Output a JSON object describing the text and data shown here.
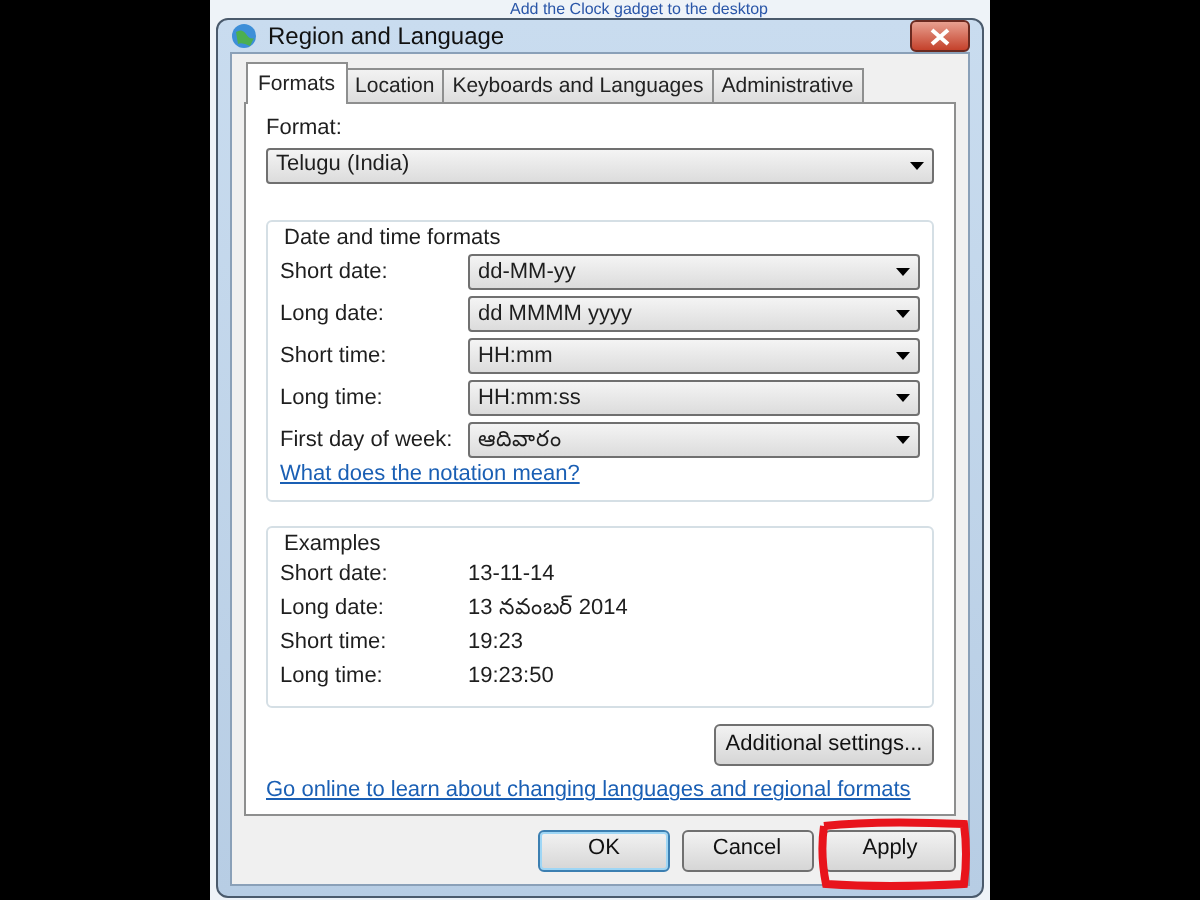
{
  "background_text": "Add the Clock gadget to the desktop",
  "window": {
    "title": "Region and Language"
  },
  "tabs": [
    {
      "label": "Formats",
      "selected": true
    },
    {
      "label": "Location",
      "selected": false
    },
    {
      "label": "Keyboards and Languages",
      "selected": false
    },
    {
      "label": "Administrative",
      "selected": false
    }
  ],
  "format": {
    "label": "Format:",
    "value": "Telugu (India)"
  },
  "date_time_formats": {
    "title": "Date and time formats",
    "fields": [
      {
        "label": "Short date:",
        "value": "dd-MM-yy"
      },
      {
        "label": "Long date:",
        "value": "dd MMMM yyyy"
      },
      {
        "label": "Short time:",
        "value": "HH:mm"
      },
      {
        "label": "Long time:",
        "value": "HH:mm:ss"
      },
      {
        "label": "First day of week:",
        "value": "ఆదివారం"
      }
    ],
    "link": "What does the notation mean?"
  },
  "examples": {
    "title": "Examples",
    "rows": [
      {
        "label": "Short date:",
        "value": "13-11-14"
      },
      {
        "label": "Long date:",
        "value": "13 నవంబర్ 2014"
      },
      {
        "label": "Short time:",
        "value": "19:23"
      },
      {
        "label": "Long time:",
        "value": "19:23:50"
      }
    ]
  },
  "additional_settings_button": "Additional settings...",
  "online_link": "Go online to learn about changing languages and regional formats",
  "buttons": [
    {
      "label": "OK",
      "default": true,
      "highlighted": false
    },
    {
      "label": "Cancel",
      "default": false,
      "highlighted": false
    },
    {
      "label": "Apply",
      "default": false,
      "highlighted": true
    }
  ]
}
